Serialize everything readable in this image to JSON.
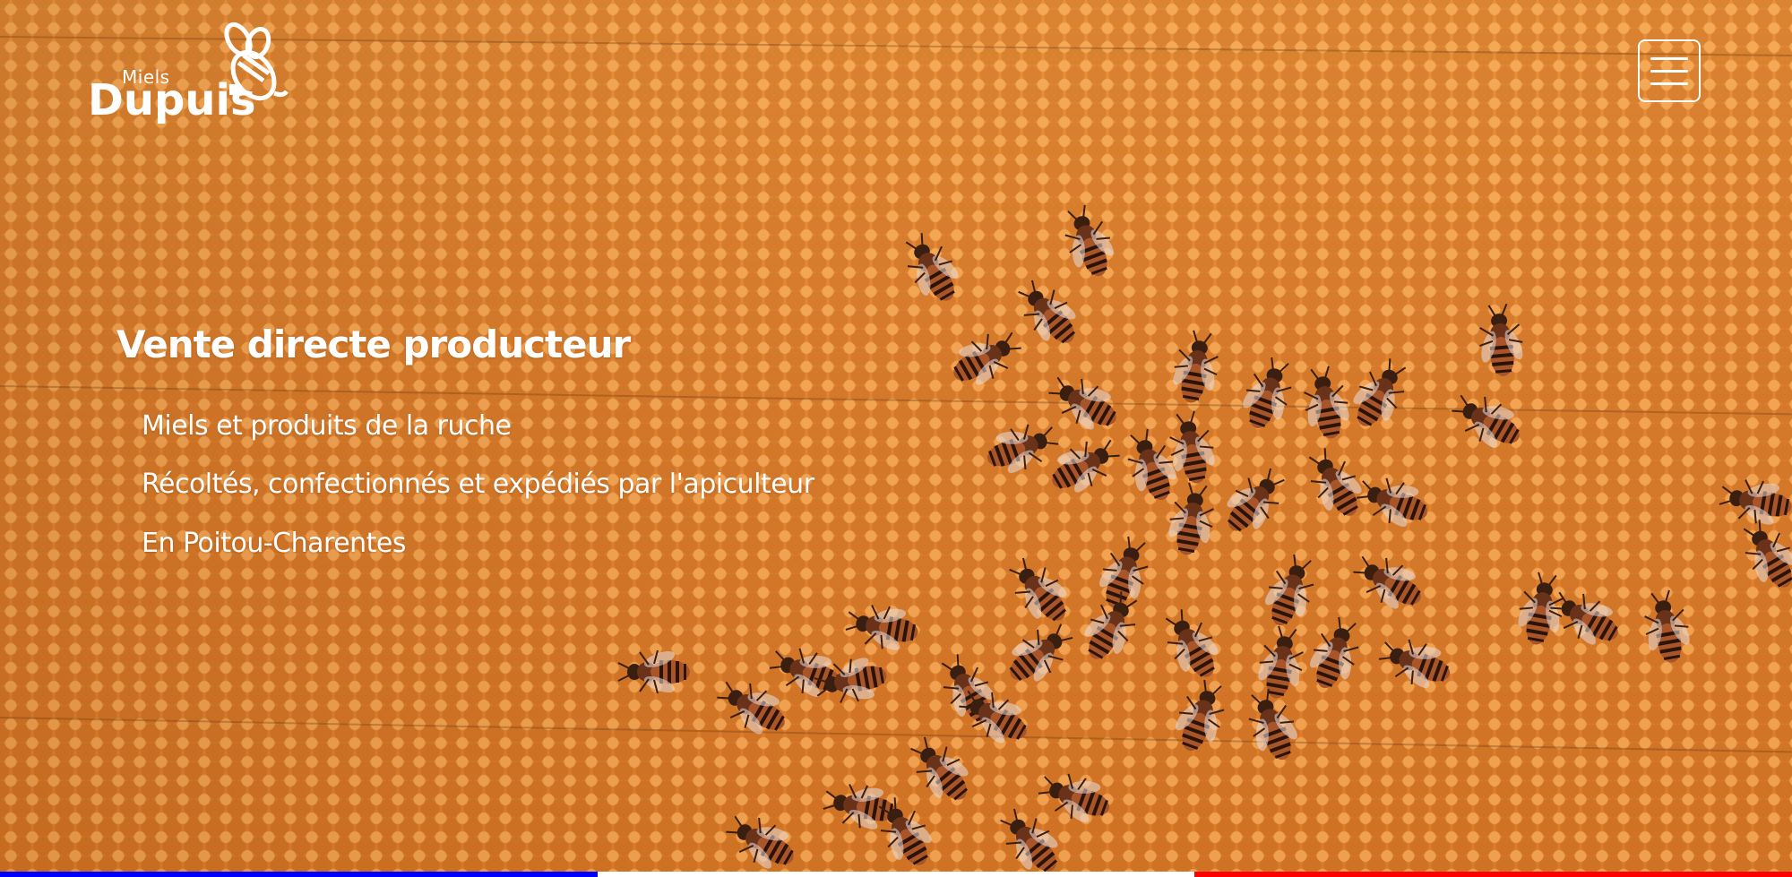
{
  "brand": {
    "small_text": "Miels",
    "name": "Dupuis",
    "logo_icon": "bee-icon"
  },
  "header": {
    "menu_icon": "hamburger-menu-icon"
  },
  "hero": {
    "headline": "Vente directe producteur",
    "lines": [
      "Miels et produits de la ruche",
      "Récoltés, confectionnés et expédiés par l'apiculteur",
      "En Poitou-Charentes"
    ]
  },
  "footer_band": {
    "colors": [
      "#0000ff",
      "#ffffff",
      "#ff0000"
    ]
  },
  "colors": {
    "background": "#e58a30",
    "text": "#ffffff"
  }
}
